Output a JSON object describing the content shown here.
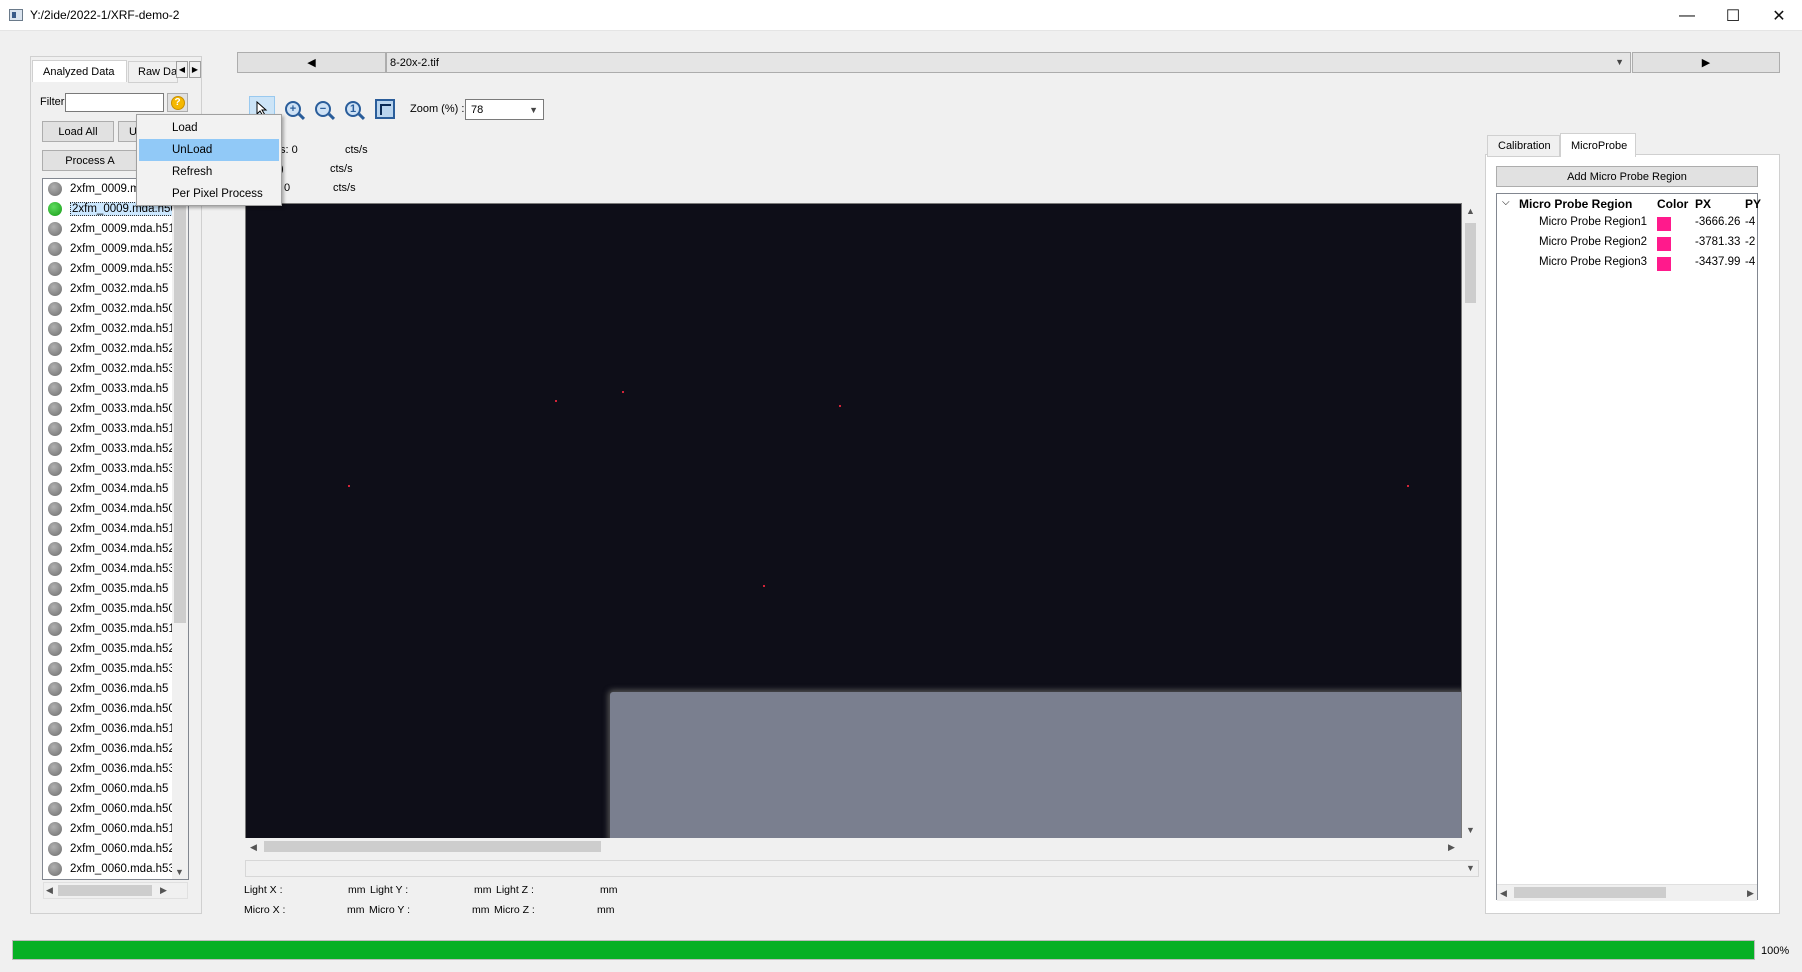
{
  "window": {
    "title": "Y:/2ide/2022-1/XRF-demo-2",
    "minimize": "—",
    "maximize": "☐",
    "close": "✕"
  },
  "left": {
    "tabs": [
      "Analyzed Data",
      "Raw Da"
    ],
    "filter_label": "Filter",
    "filter_value": "",
    "help_glyph": "?",
    "load_all": "Load All",
    "unload_all": "U",
    "process_all": "Process A",
    "files": [
      {
        "name": "2xfm_0009.mda.h5",
        "loaded": false
      },
      {
        "name": "2xfm_0009.mda.h50",
        "loaded": true
      },
      {
        "name": "2xfm_0009.mda.h51",
        "loaded": false
      },
      {
        "name": "2xfm_0009.mda.h52",
        "loaded": false
      },
      {
        "name": "2xfm_0009.mda.h53",
        "loaded": false
      },
      {
        "name": "2xfm_0032.mda.h5",
        "loaded": false
      },
      {
        "name": "2xfm_0032.mda.h50",
        "loaded": false
      },
      {
        "name": "2xfm_0032.mda.h51",
        "loaded": false
      },
      {
        "name": "2xfm_0032.mda.h52",
        "loaded": false
      },
      {
        "name": "2xfm_0032.mda.h53",
        "loaded": false
      },
      {
        "name": "2xfm_0033.mda.h5",
        "loaded": false
      },
      {
        "name": "2xfm_0033.mda.h50",
        "loaded": false
      },
      {
        "name": "2xfm_0033.mda.h51",
        "loaded": false
      },
      {
        "name": "2xfm_0033.mda.h52",
        "loaded": false
      },
      {
        "name": "2xfm_0033.mda.h53",
        "loaded": false
      },
      {
        "name": "2xfm_0034.mda.h5",
        "loaded": false
      },
      {
        "name": "2xfm_0034.mda.h50",
        "loaded": false
      },
      {
        "name": "2xfm_0034.mda.h51",
        "loaded": false
      },
      {
        "name": "2xfm_0034.mda.h52",
        "loaded": false
      },
      {
        "name": "2xfm_0034.mda.h53",
        "loaded": false
      },
      {
        "name": "2xfm_0035.mda.h5",
        "loaded": false
      },
      {
        "name": "2xfm_0035.mda.h50",
        "loaded": false
      },
      {
        "name": "2xfm_0035.mda.h51",
        "loaded": false
      },
      {
        "name": "2xfm_0035.mda.h52",
        "loaded": false
      },
      {
        "name": "2xfm_0035.mda.h53",
        "loaded": false
      },
      {
        "name": "2xfm_0036.mda.h5",
        "loaded": false
      },
      {
        "name": "2xfm_0036.mda.h50",
        "loaded": false
      },
      {
        "name": "2xfm_0036.mda.h51",
        "loaded": false
      },
      {
        "name": "2xfm_0036.mda.h52",
        "loaded": false
      },
      {
        "name": "2xfm_0036.mda.h53",
        "loaded": false
      },
      {
        "name": "2xfm_0060.mda.h5",
        "loaded": false
      },
      {
        "name": "2xfm_0060.mda.h50",
        "loaded": false
      },
      {
        "name": "2xfm_0060.mda.h51",
        "loaded": false
      },
      {
        "name": "2xfm_0060.mda.h52",
        "loaded": false
      },
      {
        "name": "2xfm_0060.mda.h53",
        "loaded": false
      }
    ],
    "loaded_color": "#169b16",
    "unloaded_color": "#6d6d6d"
  },
  "context_menu": {
    "items": [
      "Load",
      "UnLoad",
      "Refresh",
      "Per Pixel Process"
    ],
    "highlighted": "UnLoad"
  },
  "image_nav": {
    "prev": "◀",
    "selected_image": "8-20x-2.tif",
    "next": "▶"
  },
  "toolbar": {
    "zoom_label": "Zoom (%) :",
    "zoom_value": "78"
  },
  "stats": {
    "line1_value": "s: 0",
    "line2_value": ")",
    "line3_value": "0",
    "unit": "cts/s"
  },
  "coords": {
    "light_x": "Light X :",
    "light_y": "Light Y :",
    "light_z": "Light Z :",
    "micro_x": "Micro X :",
    "micro_y": "Micro Y :",
    "micro_z": "Micro Z :",
    "unit": "mm"
  },
  "right": {
    "tabs": [
      "Calibration",
      "MicroProbe"
    ],
    "add_region": "Add Micro Probe Region",
    "tree_title": "Micro Probe Region",
    "col_color": "Color",
    "col_px": "PX",
    "col_py": "PY",
    "regions": [
      {
        "name": "Micro Probe Region1",
        "color": "#ff1a8c",
        "px": "-3666.26",
        "py": "-4"
      },
      {
        "name": "Micro Probe Region2",
        "color": "#ff1a8c",
        "px": "-3781.33",
        "py": "-2"
      },
      {
        "name": "Micro Probe Region3",
        "color": "#ff1a8c",
        "px": "-3437.99",
        "py": "-4"
      }
    ]
  },
  "progress": {
    "percent": 100,
    "label": "100%",
    "color": "#06b025"
  }
}
